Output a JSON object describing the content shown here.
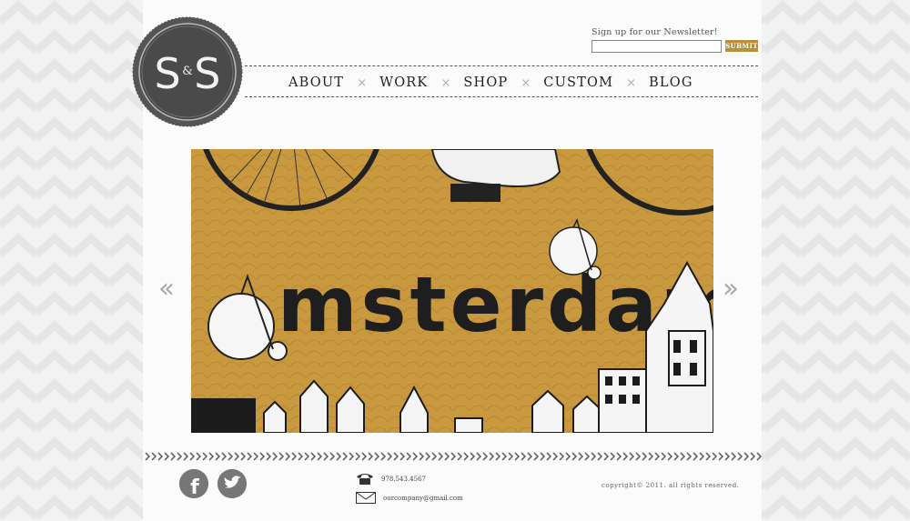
{
  "newsletter": {
    "label": "Sign up for our Newsletter!",
    "submit_label": "SUBMIT",
    "placeholder": ""
  },
  "logo": {
    "text": "S&S"
  },
  "nav": {
    "items": [
      {
        "label": "ABOUT"
      },
      {
        "label": "WORK"
      },
      {
        "label": "SHOP"
      },
      {
        "label": "CUSTOM"
      },
      {
        "label": "BLOG"
      }
    ],
    "separator": "×"
  },
  "slider": {
    "caption": "msterdam",
    "prev_label": "‹‹",
    "next_label": "››"
  },
  "footer": {
    "phone": "978.543.4567",
    "email": "ourcompany@gmail.com",
    "copyright": "copyright© 2011. all rights reserved.",
    "social": [
      {
        "icon": "facebook-icon",
        "letter": "f"
      },
      {
        "icon": "twitter-icon"
      }
    ]
  },
  "colors": {
    "accent": "#b8903a",
    "slide_bg": "#c9993f",
    "dark": "#4a4a4a"
  }
}
